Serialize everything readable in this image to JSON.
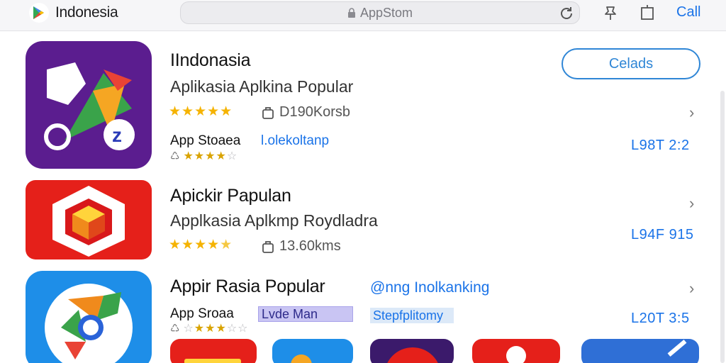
{
  "header": {
    "brand_name": "Indonesia",
    "url_text": "AppStom",
    "call_label": "Call"
  },
  "apps": [
    {
      "title": "IIndonasia",
      "subtitle": "Aplikasia Aplkina Popular",
      "stars": "★★★★★",
      "downloads": "D190Korsb",
      "store": "App Stoaea",
      "mini_rating": "★★★★",
      "mini_rating_off": "☆",
      "link": "l.olekoltanp",
      "price": "L98T 2:2",
      "get_label": "Celads"
    },
    {
      "title": "Apickir Papulan",
      "subtitle": "Applkasia Aplkmp Roydladra",
      "stars": "★★★★",
      "stars_off": "★",
      "downloads": "13.60kms",
      "price": "L94F 915"
    },
    {
      "title": "Appir Rasia Popular",
      "link_right": "@nng Inolkanking",
      "store": "App Sroaa",
      "mini_rating": "★★★",
      "mini_rating_off": "☆☆",
      "tag_purple": "Lvde Man",
      "tag_blue": "Stepfplitomy",
      "price": "L20T 3:5"
    }
  ],
  "icons": {
    "brand": "google-play-logo",
    "lock": "lock-icon",
    "reload": "reload-icon",
    "pin": "pin-icon",
    "share": "share-icon",
    "downloads": "download-box-icon",
    "chevron": "›"
  },
  "colors": {
    "accent": "#1a73e8",
    "star": "#f5b301",
    "app1_bg": "#5b1d8f",
    "app2_bg": "#e5201a",
    "app3_bg": "#1e8ee8"
  }
}
